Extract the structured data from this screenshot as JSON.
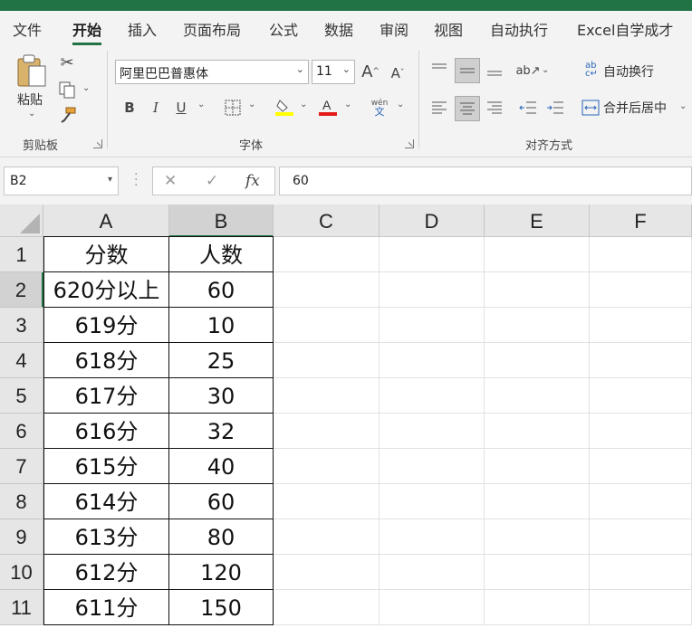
{
  "ribbon_tabs": [
    "文件",
    "开始",
    "插入",
    "页面布局",
    "公式",
    "数据",
    "审阅",
    "视图",
    "自动执行",
    "Excel自学成才"
  ],
  "active_tab": "开始",
  "clipboard": {
    "paste_label": "粘贴",
    "group_label": "剪贴板"
  },
  "font": {
    "name": "阿里巴巴普惠体",
    "size": "11",
    "group_label": "字体",
    "phonetic_top": "wén",
    "phonetic_bottom": "文"
  },
  "alignment": {
    "wrap_text": "自动换行",
    "merge_center": "合并后居中",
    "group_label": "对齐方式"
  },
  "formula_bar": {
    "name_box": "B2",
    "fx": "fx",
    "value": "60"
  },
  "colors": {
    "accent": "#217346",
    "highlight": "#ffff00",
    "font_color": "#e31b1b"
  },
  "sheet": {
    "columns": [
      "A",
      "B",
      "C",
      "D",
      "E",
      "F"
    ],
    "rows": [
      "1",
      "2",
      "3",
      "4",
      "5",
      "6",
      "7",
      "8",
      "9",
      "10",
      "11"
    ],
    "data": [
      [
        "分数",
        "人数"
      ],
      [
        "620分以上",
        "60"
      ],
      [
        "619分",
        "10"
      ],
      [
        "618分",
        "25"
      ],
      [
        "617分",
        "30"
      ],
      [
        "616分",
        "32"
      ],
      [
        "615分",
        "40"
      ],
      [
        "614分",
        "60"
      ],
      [
        "613分",
        "80"
      ],
      [
        "612分",
        "120"
      ],
      [
        "611分",
        "150"
      ]
    ]
  }
}
